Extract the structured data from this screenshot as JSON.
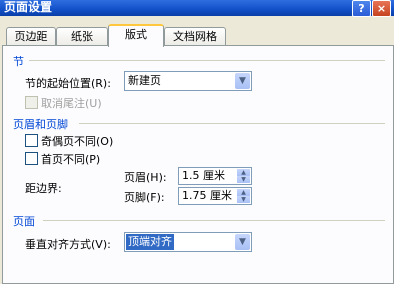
{
  "window": {
    "title": "页面设置",
    "help_glyph": "?",
    "close_glyph": "×"
  },
  "tabs": [
    {
      "label": "页边距"
    },
    {
      "label": "纸张"
    },
    {
      "label": "版式",
      "active": true
    },
    {
      "label": "文档网格"
    }
  ],
  "section_section": {
    "title": "节",
    "start_label": "节的起始位置(R):",
    "start_value": "新建页",
    "suppress_endnotes_label": "取消尾注(U)",
    "suppress_endnotes_checked": false,
    "suppress_endnotes_enabled": false
  },
  "headers_footers": {
    "title": "页眉和页脚",
    "odd_even_label": "奇偶页不同(O)",
    "odd_even_checked": false,
    "first_page_label": "首页不同(P)",
    "first_page_checked": false,
    "from_edge_label": "距边界:",
    "header_label": "页眉(H):",
    "header_value": "1.5 厘米",
    "footer_label": "页脚(F):",
    "footer_value": "1.75 厘米"
  },
  "page_section": {
    "title": "页面",
    "vertical_align_label": "垂直对齐方式(V):",
    "vertical_align_value": "顶端对齐"
  },
  "icons": {
    "dropdown": "chevron-down-icon",
    "spin_up": "arrow-up-icon",
    "spin_down": "arrow-down-icon"
  }
}
